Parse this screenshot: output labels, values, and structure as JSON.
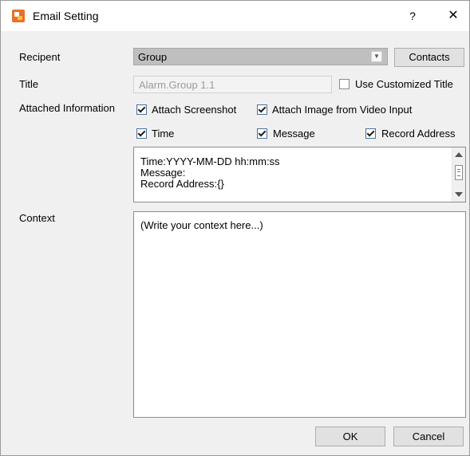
{
  "window": {
    "title": "Email Setting",
    "help": "?",
    "close": "✕"
  },
  "recipient": {
    "label": "Recipent",
    "value": "Group",
    "contacts_button": "Contacts"
  },
  "title_row": {
    "label": "Title",
    "value": "Alarm.Group 1.1",
    "custom_title_label": "Use Customized Title",
    "custom_title_checked": false
  },
  "attached": {
    "label": "Attached Information",
    "options": [
      {
        "label": "Attach Screenshot",
        "checked": true
      },
      {
        "label": "Attach Image from Video Input",
        "checked": true
      },
      {
        "label": "Time",
        "checked": true
      },
      {
        "label": "Message",
        "checked": true
      },
      {
        "label": "Record Address",
        "checked": true
      }
    ],
    "preview_lines": [
      "Time:YYYY-MM-DD hh:mm:ss",
      "Message:",
      "Record Address:{}"
    ]
  },
  "context": {
    "label": "Context",
    "placeholder": "(Write your context here...)"
  },
  "footer": {
    "ok": "OK",
    "cancel": "Cancel"
  }
}
